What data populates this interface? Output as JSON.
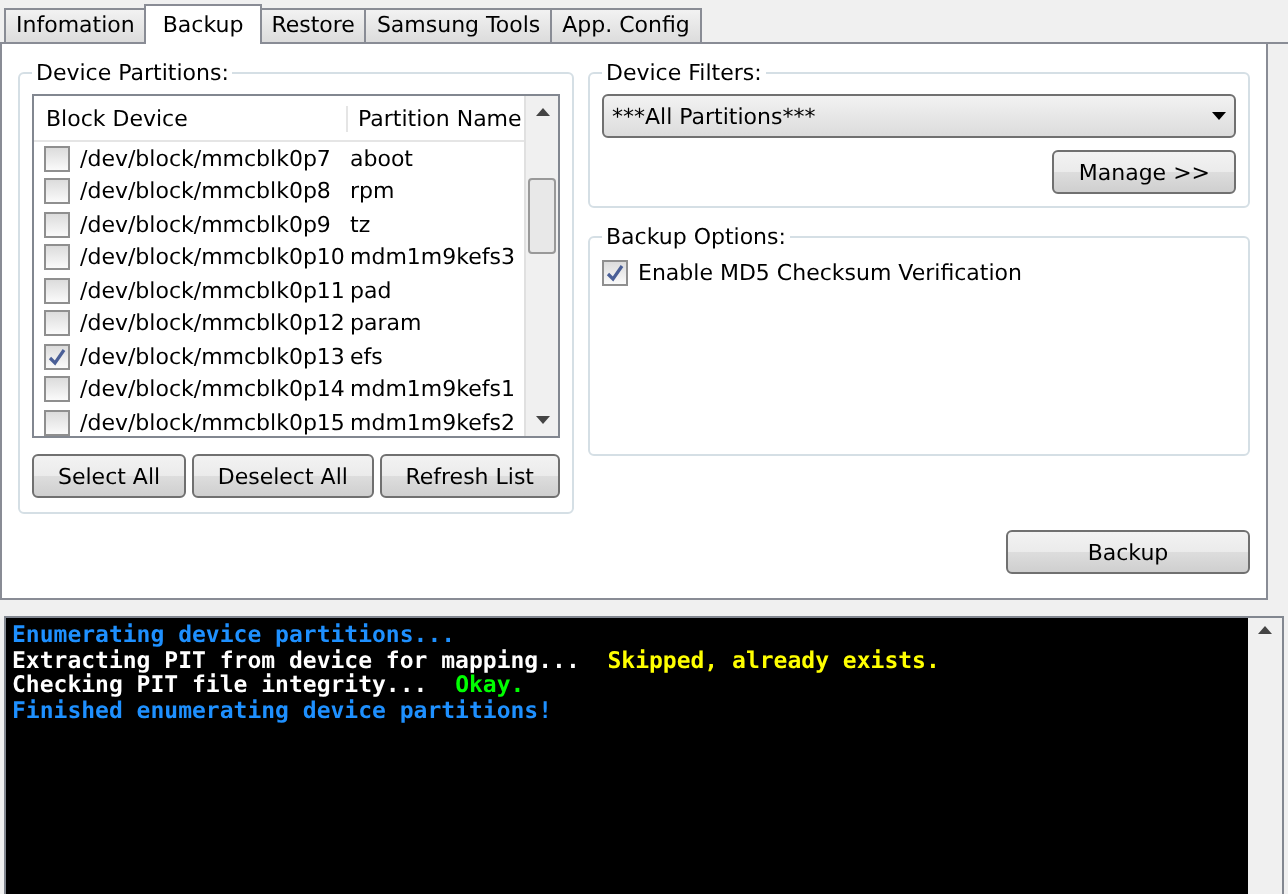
{
  "tabs": [
    {
      "label": "Infomation",
      "selected": false
    },
    {
      "label": "Backup",
      "selected": true
    },
    {
      "label": "Restore",
      "selected": false
    },
    {
      "label": "Samsung Tools",
      "selected": false
    },
    {
      "label": "App. Config",
      "selected": false
    }
  ],
  "device_partitions": {
    "title": "Device Partitions:",
    "columns": [
      "Block Device",
      "Partition Name"
    ],
    "rows": [
      {
        "device": "/dev/block/mmcblk0p7",
        "name": "aboot",
        "checked": false
      },
      {
        "device": "/dev/block/mmcblk0p8",
        "name": "rpm",
        "checked": false
      },
      {
        "device": "/dev/block/mmcblk0p9",
        "name": "tz",
        "checked": false
      },
      {
        "device": "/dev/block/mmcblk0p10",
        "name": "mdm1m9kefs3",
        "checked": false
      },
      {
        "device": "/dev/block/mmcblk0p11",
        "name": "pad",
        "checked": false
      },
      {
        "device": "/dev/block/mmcblk0p12",
        "name": "param",
        "checked": false
      },
      {
        "device": "/dev/block/mmcblk0p13",
        "name": "efs",
        "checked": true
      },
      {
        "device": "/dev/block/mmcblk0p14",
        "name": "mdm1m9kefs1",
        "checked": false
      },
      {
        "device": "/dev/block/mmcblk0p15",
        "name": "mdm1m9kefs2",
        "checked": false
      }
    ],
    "buttons": [
      "Select All",
      "Deselect All",
      "Refresh List"
    ]
  },
  "device_filters": {
    "title": "Device Filters:",
    "value": "***All Partitions***",
    "button": "Manage >>"
  },
  "backup_options": {
    "title": "Backup Options:",
    "options": [
      {
        "label": "Enable MD5 Checksum Verification",
        "checked": true
      }
    ]
  },
  "backup_button": "Backup",
  "log": [
    [
      {
        "text": "Enumerating device partitions...",
        "color": "#1e90ff"
      }
    ],
    [
      {
        "text": "Extracting PIT from device for mapping...  ",
        "color": "#ffffff"
      },
      {
        "text": "Skipped, already exists.",
        "color": "#ffff00"
      }
    ],
    [
      {
        "text": "Checking PIT file integrity...  ",
        "color": "#ffffff"
      },
      {
        "text": "Okay.",
        "color": "#00ff00"
      }
    ],
    [
      {
        "text": "Finished enumerating device partitions!",
        "color": "#1e90ff"
      }
    ]
  ]
}
